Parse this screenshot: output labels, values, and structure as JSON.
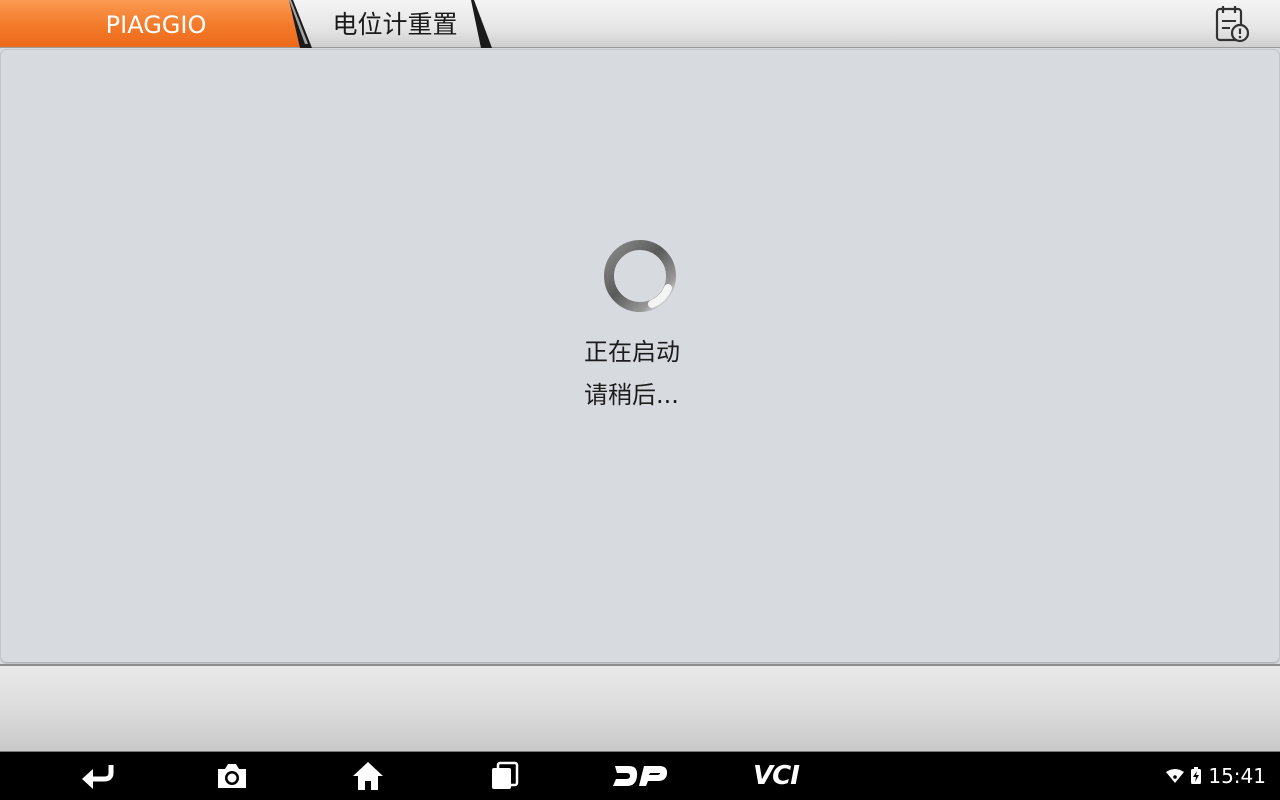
{
  "header": {
    "breadcrumbs": [
      {
        "label": "PIAGGIO"
      },
      {
        "label": "电位计重置"
      }
    ],
    "report_icon": "report-clipboard-icon"
  },
  "main": {
    "loading": {
      "line1": "正在启动",
      "line2": "请稍后..."
    }
  },
  "nav_bar": {
    "buttons": [
      "back-icon",
      "camera-icon",
      "home-icon",
      "recents-icon",
      "dp-icon",
      "vci-icon"
    ],
    "vci_label": "VCI"
  },
  "status_bar": {
    "time": "15:41"
  },
  "colors": {
    "accent_orange": "#f37a2a",
    "panel_bg": "#d7dbdf",
    "nav_bg": "#000000"
  }
}
